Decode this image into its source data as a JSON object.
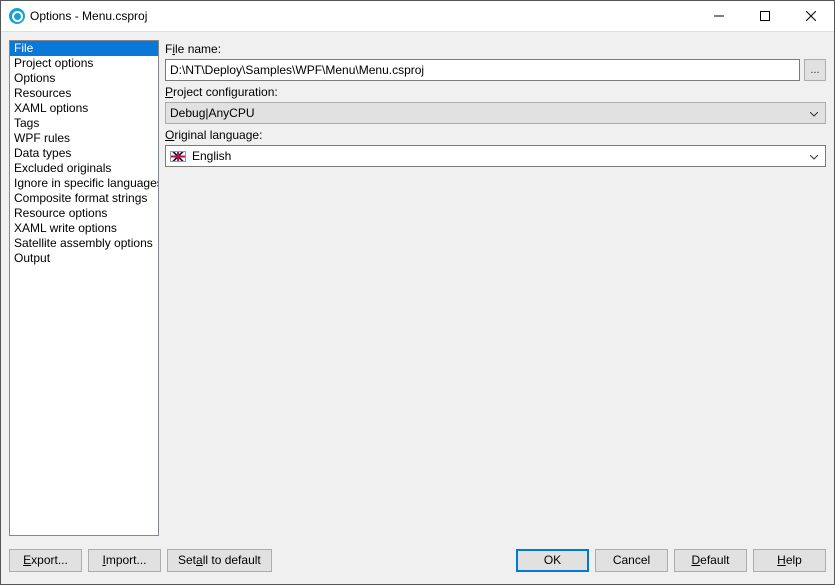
{
  "window": {
    "title": "Options - Menu.csproj"
  },
  "sidebar": {
    "items": [
      {
        "label": "File",
        "selected": true
      },
      {
        "label": "Project options",
        "selected": false
      },
      {
        "label": "Options",
        "selected": false
      },
      {
        "label": "Resources",
        "selected": false
      },
      {
        "label": "XAML options",
        "selected": false
      },
      {
        "label": "Tags",
        "selected": false
      },
      {
        "label": "WPF rules",
        "selected": false
      },
      {
        "label": "Data types",
        "selected": false
      },
      {
        "label": "Excluded originals",
        "selected": false
      },
      {
        "label": "Ignore in specific languages",
        "selected": false
      },
      {
        "label": "Composite format strings",
        "selected": false
      },
      {
        "label": "Resource options",
        "selected": false
      },
      {
        "label": "XAML write options",
        "selected": false
      },
      {
        "label": "Satellite assembly options",
        "selected": false
      },
      {
        "label": "Output",
        "selected": false
      }
    ]
  },
  "fields": {
    "file_name": {
      "label_pre": "F",
      "label_ul": "i",
      "label_post": "le name:",
      "value": "D:\\NT\\Deploy\\Samples\\WPF\\Menu\\Menu.csproj",
      "browse": "..."
    },
    "project_config": {
      "label_ul": "P",
      "label_post": "roject configuration:",
      "value": "Debug|AnyCPU"
    },
    "original_lang": {
      "label_ul": "O",
      "label_post": "riginal language:",
      "value": "English"
    }
  },
  "buttons": {
    "export": {
      "ul": "E",
      "post": "xport..."
    },
    "import": {
      "ul": "I",
      "post": "mport..."
    },
    "set_all": {
      "pre": "Set ",
      "ul": "a",
      "post": "ll to default"
    },
    "ok": {
      "text": "OK"
    },
    "cancel": {
      "text": "Cancel"
    },
    "default": {
      "ul": "D",
      "post": "efault"
    },
    "help": {
      "ul": "H",
      "post": "elp"
    }
  }
}
